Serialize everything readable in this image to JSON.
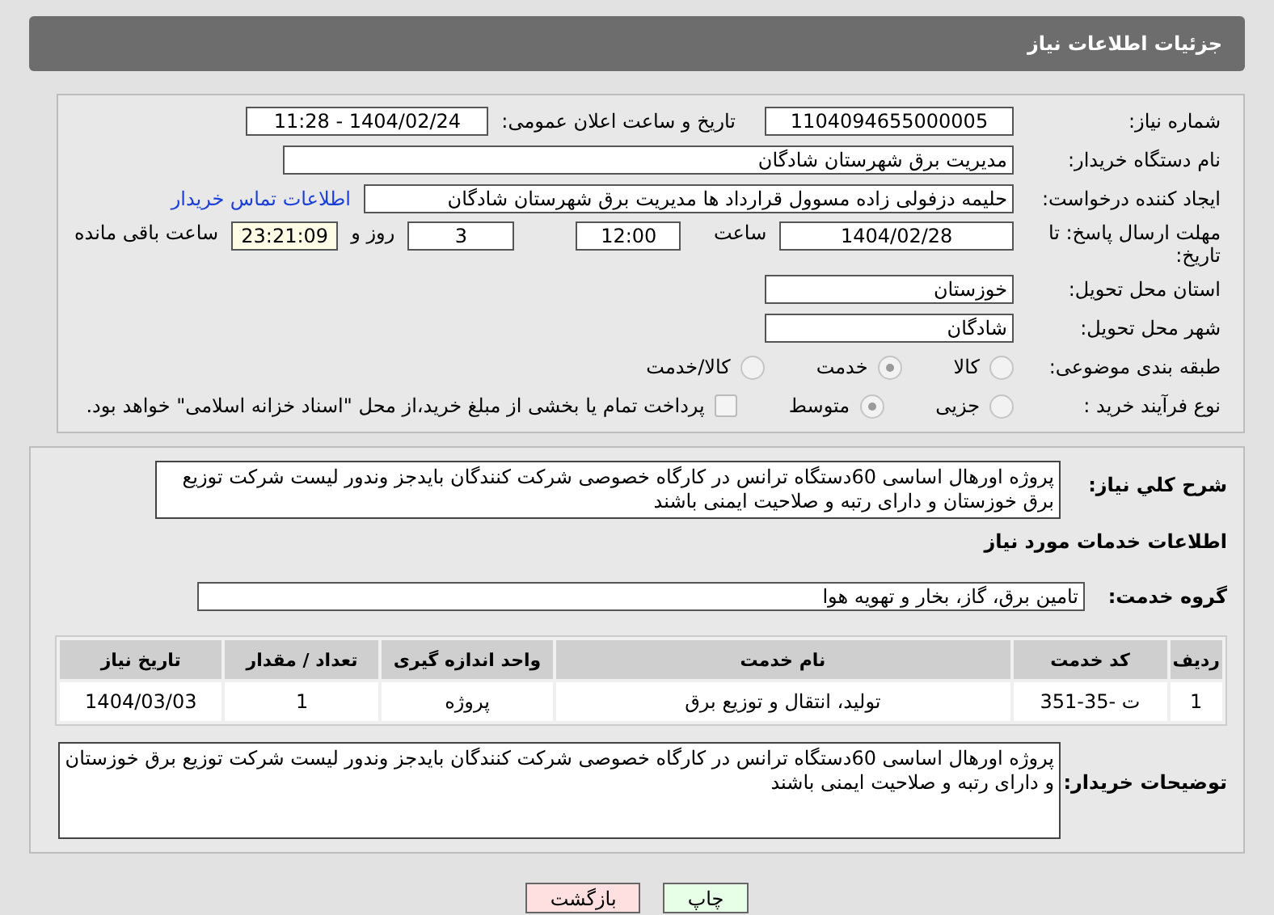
{
  "header": {
    "title": "جزئیات اطلاعات نیاز"
  },
  "info": {
    "need_number_label": "شماره نیاز:",
    "need_number": "1104094655000005",
    "announce_label": "تاریخ و ساعت اعلان عمومی:",
    "announce": "1404/02/24 - 11:28",
    "buyer_label": "نام دستگاه خریدار:",
    "buyer": "مدیریت برق شهرستان شادگان",
    "creator_label": "ایجاد کننده درخواست:",
    "creator": "حلیمه دزفولی زاده مسوول قرارداد ها مدیریت برق شهرستان شادگان",
    "contact_link": "اطلاعات تماس خریدار",
    "deadline_label": "مهلت ارسال پاسخ: تا تاریخ:",
    "deadline_date": "1404/02/28",
    "time_label": "ساعت",
    "deadline_time": "12:00",
    "days": "3",
    "days_label": "روز و",
    "remaining": "23:21:09",
    "remaining_label": "ساعت باقی مانده",
    "province_label": "استان محل تحویل:",
    "province": "خوزستان",
    "city_label": "شهر محل تحویل:",
    "city": "شادگان",
    "category_label": "طبقه بندی موضوعی:",
    "category_options": [
      {
        "label": "کالا",
        "selected": false
      },
      {
        "label": "خدمت",
        "selected": true
      },
      {
        "label": "کالا/خدمت",
        "selected": false
      }
    ],
    "process_label": "نوع فرآیند خرید :",
    "process_options": [
      {
        "label": "جزیی",
        "selected": false
      },
      {
        "label": "متوسط",
        "selected": true
      }
    ],
    "payment": {
      "label": "پرداخت تمام یا بخشی از مبلغ خرید،از محل \"اسناد خزانه اسلامی\" خواهد بود.",
      "checked": false
    }
  },
  "details": {
    "description_label": "شرح کلي نياز:",
    "description": "پروژه اورهال اساسی 60دستگاه ترانس در کارگاه خصوصی شرکت کنندگان بایدجز وندور لیست شرکت توزیع برق خوزستان و دارای رتبه و صلاحیت ایمنی باشند",
    "services_heading": "اطلاعات خدمات مورد نیاز",
    "group_label": "گروه خدمت:",
    "group": "تامین برق، گاز، بخار و تهویه هوا",
    "table": {
      "columns": [
        "ردیف",
        "کد خدمت",
        "نام خدمت",
        "واحد اندازه گیری",
        "تعداد / مقدار",
        "تاریخ نیاز"
      ],
      "rows": [
        [
          "1",
          "ت -35-351",
          "تولید، انتقال و توزیع برق",
          "پروژه",
          "1",
          "1404/03/03"
        ]
      ]
    },
    "notes_label": "توضیحات خریدار:",
    "notes": "پروژه اورهال اساسی 60دستگاه ترانس در کارگاه خصوصی شرکت کنندگان بایدجز وندور لیست شرکت توزیع برق خوزستان و دارای رتبه و صلاحیت ایمنی باشند"
  },
  "buttons": [
    {
      "label": "چاپ",
      "kind": "print"
    },
    {
      "label": "بازگشت",
      "kind": "back"
    }
  ]
}
